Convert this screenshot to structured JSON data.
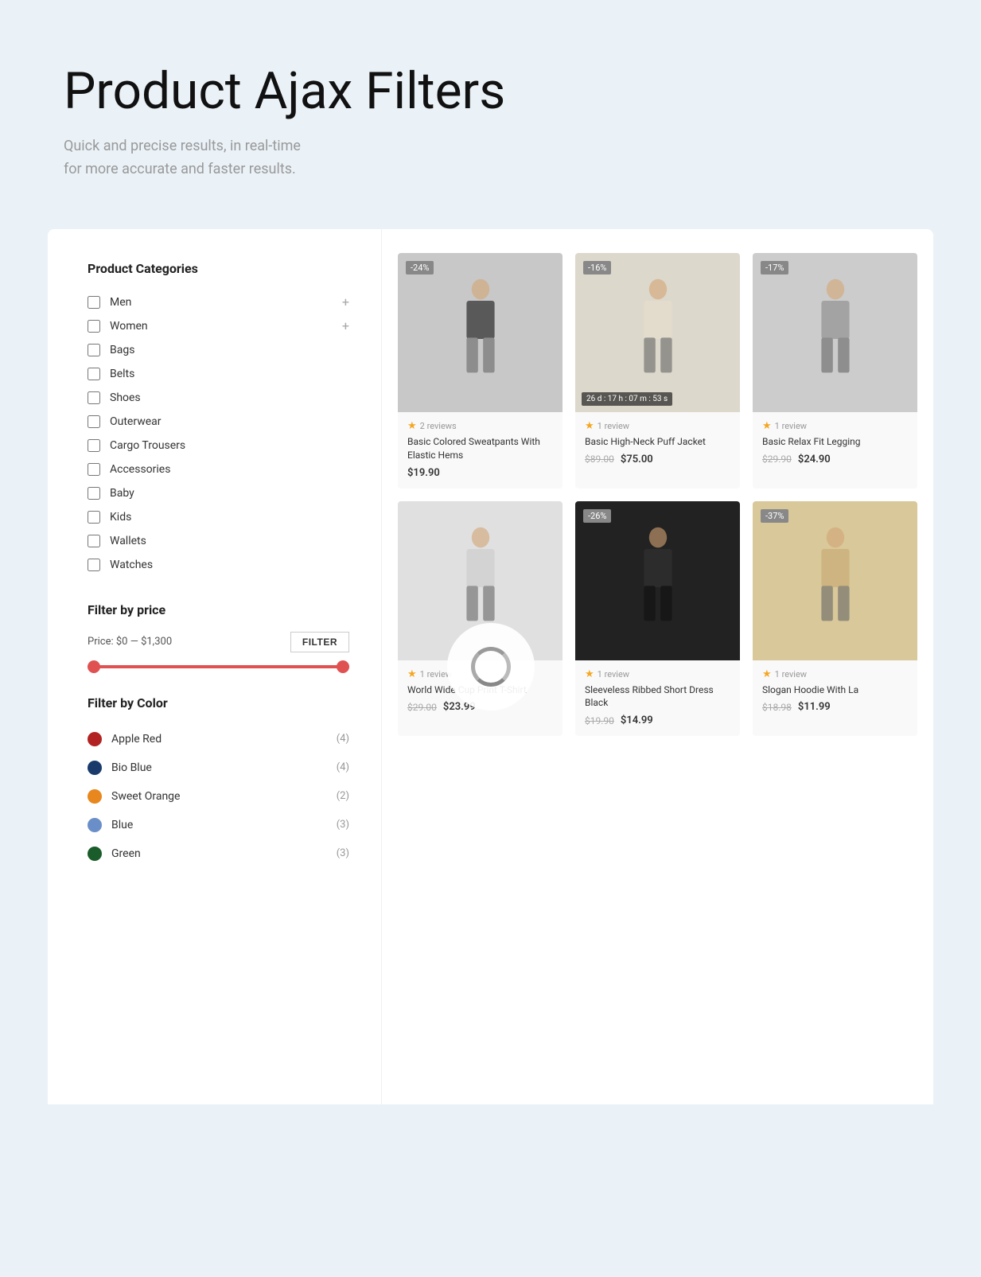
{
  "hero": {
    "title": "Product Ajax Filters",
    "subtitle_line1": "Quick and precise results, in real-time",
    "subtitle_line2": "for more accurate and faster results."
  },
  "sidebar": {
    "categories_title": "Product Categories",
    "categories": [
      {
        "id": "men",
        "label": "Men",
        "has_expand": true,
        "checked": false
      },
      {
        "id": "women",
        "label": "Women",
        "has_expand": true,
        "checked": false
      },
      {
        "id": "bags",
        "label": "Bags",
        "has_expand": false,
        "checked": false
      },
      {
        "id": "belts",
        "label": "Belts",
        "has_expand": false,
        "checked": false
      },
      {
        "id": "shoes",
        "label": "Shoes",
        "has_expand": false,
        "checked": false
      },
      {
        "id": "outerwear",
        "label": "Outerwear",
        "has_expand": false,
        "checked": false
      },
      {
        "id": "cargo-trousers",
        "label": "Cargo Trousers",
        "has_expand": false,
        "checked": false
      },
      {
        "id": "accessories",
        "label": "Accessories",
        "has_expand": false,
        "checked": false
      },
      {
        "id": "baby",
        "label": "Baby",
        "has_expand": false,
        "checked": false
      },
      {
        "id": "kids",
        "label": "Kids",
        "has_expand": false,
        "checked": false
      },
      {
        "id": "wallets",
        "label": "Wallets",
        "has_expand": false,
        "checked": false
      },
      {
        "id": "watches",
        "label": "Watches",
        "has_expand": false,
        "checked": false
      }
    ],
    "price_filter": {
      "title": "Filter by price",
      "price_label": "Price:",
      "price_range": "$0 — $1,300",
      "filter_btn": "FILTER"
    },
    "color_filter": {
      "title": "Filter by Color",
      "colors": [
        {
          "id": "apple-red",
          "label": "Apple Red",
          "count": "(4)",
          "hex": "#b22222"
        },
        {
          "id": "bio-blue",
          "label": "Bio Blue",
          "count": "(4)",
          "hex": "#1a3a6b"
        },
        {
          "id": "sweet-orange",
          "label": "Sweet Orange",
          "count": "(2)",
          "hex": "#e8871e"
        },
        {
          "id": "blue",
          "label": "Blue",
          "count": "(3)",
          "hex": "#6a8fc8"
        },
        {
          "id": "green",
          "label": "Green",
          "count": "(3)",
          "hex": "#1a5c2a"
        }
      ]
    }
  },
  "products": {
    "items": [
      {
        "id": 1,
        "badge": "-24%",
        "badge_type": "normal",
        "rating": 2,
        "reviews": "2 reviews",
        "name": "Basic Colored Sweatpants With Elastic Hems",
        "price_old": "",
        "price_new": "$19.90",
        "has_timer": false,
        "bg": "#d8d8d8",
        "person_color": "#222"
      },
      {
        "id": 2,
        "badge": "-16%",
        "badge_type": "normal",
        "rating": 2,
        "reviews": "1 review",
        "name": "Basic High-Neck Puff Jacket",
        "price_old": "$89.00",
        "price_new": "$75.00",
        "has_timer": true,
        "timer": "26 d : 17 h : 07 m : 53 s",
        "bg": "#e8e0d8",
        "person_color": "#c8b89a"
      },
      {
        "id": 3,
        "badge": "-17%",
        "badge_type": "normal",
        "rating": 2,
        "reviews": "1 review",
        "name": "Basic Relax Fit Legging",
        "price_old": "$29.90",
        "price_new": "$24.90",
        "has_timer": false,
        "bg": "#d8d8d8",
        "person_color": "#888"
      },
      {
        "id": 4,
        "badge": "",
        "badge_type": "",
        "rating": 2,
        "reviews": "1 review",
        "name": "World Wide Cup Print T-Shirt",
        "price_old": "$29.00",
        "price_new": "$23.99",
        "has_timer": false,
        "bg": "#e8e8e8",
        "person_color": "#ddd"
      },
      {
        "id": 5,
        "badge": "-26%",
        "badge_type": "normal",
        "rating": 2,
        "reviews": "1 review",
        "name": "Sleeveless Ribbed Short Dress Black",
        "price_old": "$19.90",
        "price_new": "$14.99",
        "has_timer": false,
        "bg": "#2a2a2a",
        "person_color": "#555"
      },
      {
        "id": 6,
        "badge": "-37%",
        "badge_type": "normal",
        "rating": 2,
        "reviews": "1 review",
        "name": "Slogan Hoodie With La",
        "price_old": "$18.98",
        "price_new": "$11.99",
        "has_timer": false,
        "bg": "#e8dcc8",
        "person_color": "#c8a87a"
      }
    ]
  }
}
